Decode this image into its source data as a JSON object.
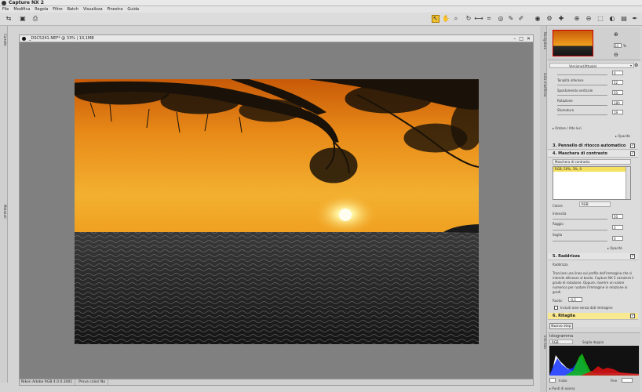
{
  "app": {
    "title": "Capture NX 2"
  },
  "menu": [
    "File",
    "Modifica",
    "Regola",
    "Filtro",
    "Batch",
    "Visualizza",
    "Finestra",
    "Guida"
  ],
  "document": {
    "title": "_DSC5241.NEF* @ 33% | 10,1MB",
    "status": [
      "Nikon Adobe RGB 4.0.0.3001",
      "Prova colori No"
    ]
  },
  "navigator": {
    "zoom": "33",
    "zoom_unit": "%"
  },
  "lefttabs": [
    "Cartelle",
    "Metadati"
  ],
  "righttabs": [
    "Navigatore",
    "Lista modifiche",
    "Info foto"
  ],
  "steps": {
    "version_label": "Versione:",
    "version_value": "(Attuale)",
    "fields": [
      {
        "label": "Tonalità inferiore",
        "value": "52"
      },
      {
        "label": "Spostamento verticale",
        "value": "50"
      },
      {
        "label": "Rotazione",
        "value": "180"
      },
      {
        "label": "Sfumatura",
        "value": "19"
      }
    ],
    "first_value": "0",
    "ombre": "Ombre / Alte luci",
    "opacity_label": "Opacità",
    "step3": "3. Pennello di ritocco automatico",
    "step4": "4. Maschera di contrasto",
    "step4_select": "Maschera di contrasto",
    "step4_list_item": "RGB, 50%, 3%, 0",
    "colore_label": "Colore",
    "colore_value": "RGB",
    "step4_fields": [
      {
        "label": "Intensità",
        "value": "50"
      },
      {
        "label": "Raggio",
        "value": "3"
      },
      {
        "label": "Soglia",
        "value": "0"
      }
    ],
    "step5": "5. Raddrizza",
    "step5_sub": "Raddrizza",
    "step5_desc": "Tracciare una linea sul profilo dell'immagine che si intende allineare al bordo. Capture NX 2 calcolerà il grado di rotazione. Oppure, inserire un valore numerico per ruotare l'immagine in relazione ai gradi.",
    "ruota_label": "Ruota:",
    "ruota_value": "-0,5",
    "include_label": "Includi aree senza dati immagine",
    "step6": "6. Ritaglia",
    "new_step": "Nuovo step"
  },
  "histogram": {
    "title": "Istogramma",
    "channel": "RGB",
    "mode": "Soglia doppia",
    "start_label": "Inizio",
    "end_label": "Fine",
    "colors": {
      "red": "#e01010",
      "green": "#10c010",
      "blue": "#1030ff",
      "white": "#ffffff"
    }
  },
  "footer": {
    "label": "Punti di ossery"
  }
}
